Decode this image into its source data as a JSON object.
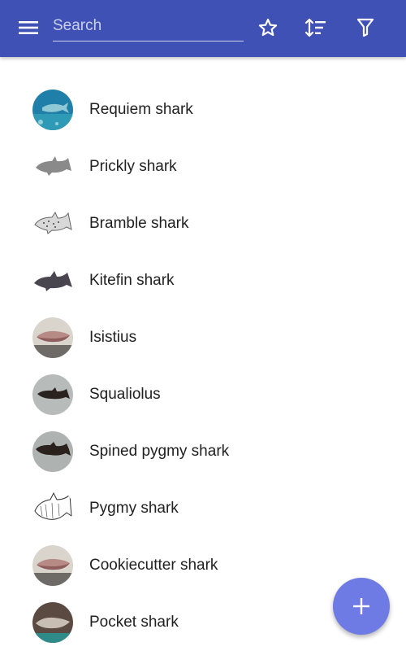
{
  "toolbar": {
    "search_placeholder": "Search",
    "menu_icon": "menu-icon",
    "star_icon": "star-outline-icon",
    "sort_icon": "sort-icon",
    "filter_icon": "filter-icon"
  },
  "list": {
    "items": [
      {
        "label": "Requiem shark",
        "thumb": "photo-underwater-shark"
      },
      {
        "label": "Prickly shark",
        "thumb": "drawing-gray-shark"
      },
      {
        "label": "Bramble shark",
        "thumb": "drawing-spotted-shark"
      },
      {
        "label": "Kitefin shark",
        "thumb": "drawing-dark-shark"
      },
      {
        "label": "Isistius",
        "thumb": "photo-fish-on-table"
      },
      {
        "label": "Squaliolus",
        "thumb": "photo-small-dark-shark"
      },
      {
        "label": "Spined pygmy shark",
        "thumb": "photo-small-dark-shark"
      },
      {
        "label": "Pygmy shark",
        "thumb": "sketch-shark"
      },
      {
        "label": "Cookiecutter shark",
        "thumb": "photo-fish-on-table"
      },
      {
        "label": "Pocket shark",
        "thumb": "photo-shark-specimen"
      }
    ]
  },
  "fab": {
    "icon": "plus-icon"
  },
  "colors": {
    "appbar": "#3f51b5",
    "fab": "#6f7be4",
    "text": "#212121"
  }
}
